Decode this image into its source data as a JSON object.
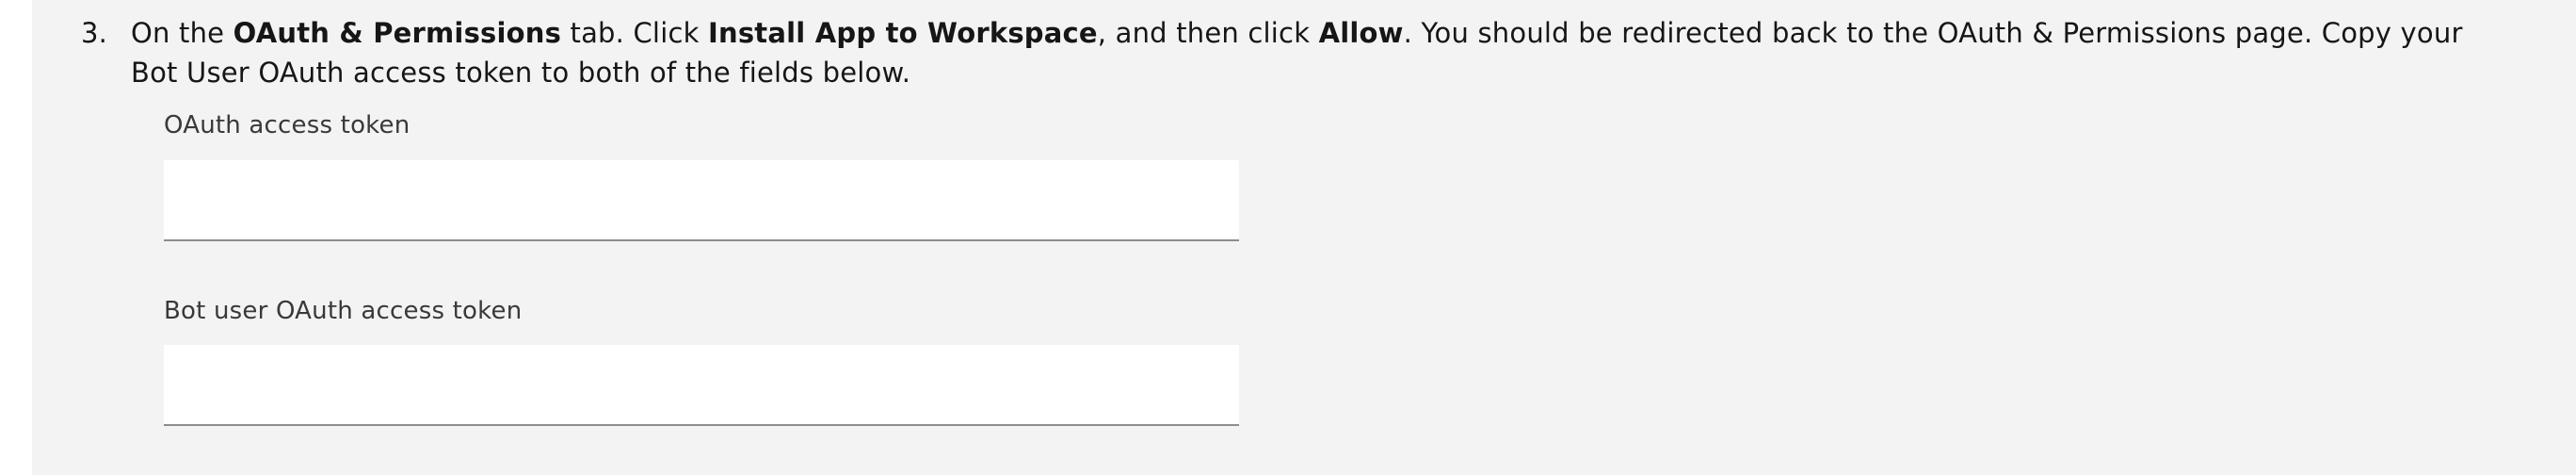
{
  "step": {
    "number": "3.",
    "text": {
      "prefix": "On the ",
      "bold_tab": "OAuth & Permissions",
      "middle1": " tab. Click ",
      "bold_install": "Install App to Workspace",
      "middle2": ", and then click ",
      "bold_allow": "Allow",
      "suffix": ". You should be redirected back to the OAuth & Permissions page. Copy your Bot User OAuth access token to both of the fields below."
    }
  },
  "fields": {
    "oauth": {
      "label": "OAuth access token",
      "value": "",
      "placeholder": ""
    },
    "bot": {
      "label": "Bot user OAuth access token",
      "value": "",
      "placeholder": ""
    }
  },
  "colors": {
    "panel_background": "#f3f3f3",
    "input_background": "#ffffff",
    "input_border": "#8d8d8d",
    "text": "#161616",
    "label_text": "#393939"
  }
}
